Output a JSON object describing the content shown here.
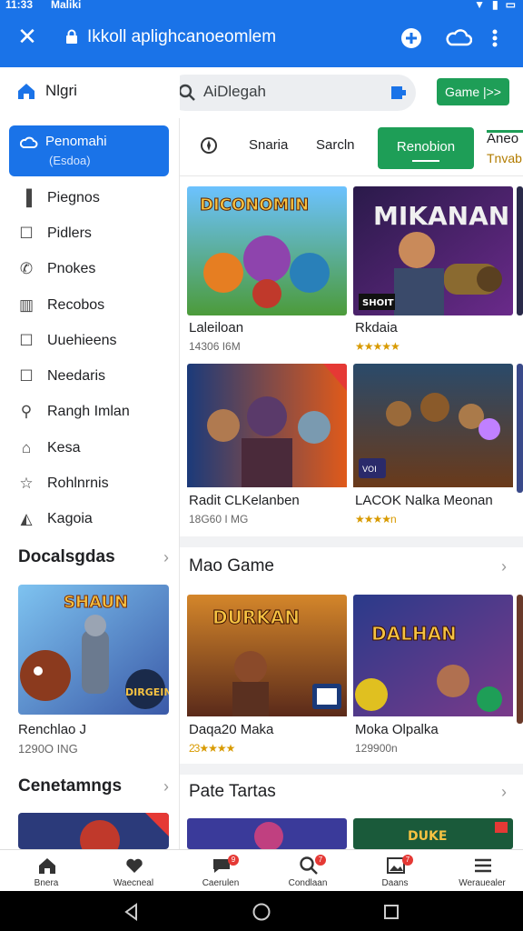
{
  "status_bar": {
    "time": "11:33",
    "carrier": "Maliki"
  },
  "topbar": {
    "url": "Ikkoll aplighcanoeomlem"
  },
  "sidebar": {
    "header": "Nlgri",
    "active": {
      "label": "Penomahi",
      "sublabel": "(Esdoa)"
    },
    "items": [
      {
        "label": "Piegnos",
        "icon": "book-icon"
      },
      {
        "label": "Pidlers",
        "icon": "square-icon"
      },
      {
        "label": "Pnokes",
        "icon": "phone-icon"
      },
      {
        "label": "Recobos",
        "icon": "trash-icon"
      },
      {
        "label": "Uuehieens",
        "icon": "square-icon"
      },
      {
        "label": "Needaris",
        "icon": "square-icon"
      },
      {
        "label": "Rangh Imlan",
        "icon": "search-icon"
      },
      {
        "label": "Kesa",
        "icon": "home-icon"
      },
      {
        "label": "Rohlnrnis",
        "icon": "star-icon"
      },
      {
        "label": "Kagoia",
        "icon": "tag-icon"
      }
    ],
    "section1": {
      "title": "Docalsgdas",
      "card_title": "Renchlao J",
      "card_sub": "1290O ING"
    },
    "section2": {
      "title": "Cenetamngs"
    }
  },
  "search": {
    "text": "AiDlegah"
  },
  "game_button": "Game |>>",
  "tabs": {
    "t1": "Snaria",
    "t2": "Sarcln",
    "active": "Renobion",
    "last1": "Aneo",
    "last2": "Tnvab"
  },
  "grid": [
    {
      "title": "Laleiloan",
      "sub": "14306 I6M",
      "stars": ""
    },
    {
      "title": "Rkdaia",
      "sub": "",
      "stars": "★★★★★"
    },
    {
      "title": "Radit CLKelanben",
      "sub": "18G60 I MG",
      "stars": ""
    },
    {
      "title": "LACOK Nalka Meonan",
      "sub": "",
      "stars": "★★★★n"
    }
  ],
  "section_main": {
    "title": "Mao Game",
    "cards": [
      {
        "title": "Daqa20 Maka",
        "stars": "23★★★★"
      },
      {
        "title": "Moka Olpalka",
        "sub": "129900n"
      }
    ]
  },
  "section_pate": {
    "title": "Pate Tartas"
  },
  "bottom_nav": [
    {
      "label": "Bnera",
      "icon": "home-icon"
    },
    {
      "label": "Waecneal",
      "icon": "heart-icon"
    },
    {
      "label": "Caerulen",
      "icon": "chat-icon",
      "badge": "9"
    },
    {
      "label": "Condlaan",
      "icon": "search-icon",
      "badge": "7"
    },
    {
      "label": "Daans",
      "icon": "image-icon",
      "badge": "7"
    },
    {
      "label": "Werauealer",
      "icon": "menu-icon"
    }
  ],
  "colors": {
    "primary": "#1a73e8",
    "green": "#1e9e57"
  }
}
